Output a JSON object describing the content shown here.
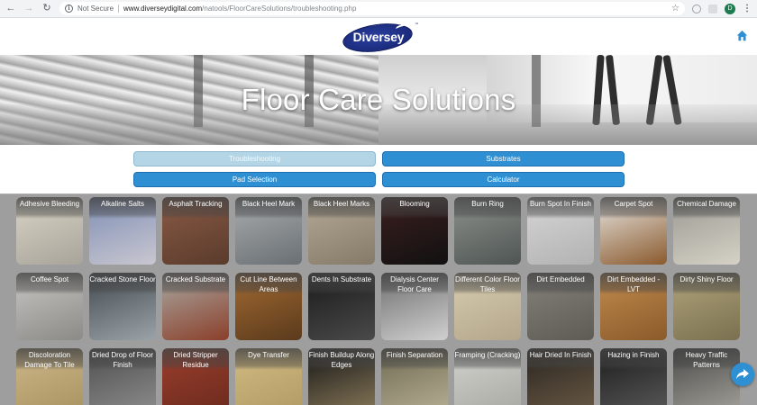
{
  "browser": {
    "security": "Not Secure",
    "url_host": "www.diverseydigital.com",
    "url_path": "/natools/FloorCareSolutions/troubleshooting.php",
    "profile_initial": "D"
  },
  "header": {
    "logo_text": "Diversey",
    "logo_tm": "™"
  },
  "hero": {
    "title": "Floor Care Solutions"
  },
  "nav_buttons": {
    "troubleshooting": "Troubleshooting",
    "substrates": "Substrates",
    "pad_selection": "Pad Selection",
    "calculator": "Calculator"
  },
  "colors": {
    "accent": "#2f8fd3",
    "active_button": "#b4d5e5",
    "brand_navy": "#1a2a7a"
  },
  "tiles": [
    {
      "label": "Adhesive Bleeding",
      "c1": "#d9d4c6",
      "c2": "#a8a49a"
    },
    {
      "label": "Alkaline Salts",
      "c1": "#7f8fb5",
      "c2": "#c9c7d0"
    },
    {
      "label": "Asphalt Tracking",
      "c1": "#8a5a45",
      "c2": "#5a3b2c"
    },
    {
      "label": "Black Heel Mark",
      "c1": "#a9adb0",
      "c2": "#6a6f73"
    },
    {
      "label": "Black Heel Marks",
      "c1": "#b5aa97",
      "c2": "#857a68"
    },
    {
      "label": "Blooming",
      "c1": "#3d1f1f",
      "c2": "#111111"
    },
    {
      "label": "Burn Ring",
      "c1": "#8c918e",
      "c2": "#4f5552"
    },
    {
      "label": "Burn Spot In Finish",
      "c1": "#d6d6d6",
      "c2": "#b2b2b2"
    },
    {
      "label": "Carpet Spot",
      "c1": "#e8e6e2",
      "c2": "#8a5a2e"
    },
    {
      "label": "Chemical Damage",
      "c1": "#9a9a92",
      "c2": "#d5d1c6"
    },
    {
      "label": "Coffee Spot",
      "c1": "#c8c6c2",
      "c2": "#8c8a86"
    },
    {
      "label": "Cracked Stone Floor",
      "c1": "#434a4f",
      "c2": "#9aa3a8"
    },
    {
      "label": "Cracked Substrate",
      "c1": "#a9a9a3",
      "c2": "#8b3f2a"
    },
    {
      "label": "Cut Line Between Areas",
      "c1": "#a36a32",
      "c2": "#5a3a1c"
    },
    {
      "label": "Dents In Substrate",
      "c1": "#1a1a1a",
      "c2": "#4a4a4a"
    },
    {
      "label": "Dialysis Center Floor Care",
      "c1": "#6f6f6f",
      "c2": "#d0d0d0"
    },
    {
      "label": "Different Color Floor Tiles",
      "c1": "#d8ccb0",
      "c2": "#b3a68a"
    },
    {
      "label": "Dirt Embedded",
      "c1": "#85827b",
      "c2": "#5e5b55"
    },
    {
      "label": "Dirt Embedded - LVT",
      "c1": "#c28c4e",
      "c2": "#8a5a2a"
    },
    {
      "label": "Dirty Shiny Floor",
      "c1": "#b0a47a",
      "c2": "#7a7050"
    },
    {
      "label": "Discoloration Damage To Tile",
      "c1": "#cdb78a",
      "c2": "#a8925f"
    },
    {
      "label": "Dried Drop of Floor Finish",
      "c1": "#4e4e4e",
      "c2": "#8e8e8e"
    },
    {
      "label": "Dried Stripper Residue",
      "c1": "#9b3e2c",
      "c2": "#6a2a1d"
    },
    {
      "label": "Dye Transfer",
      "c1": "#d3bb83",
      "c2": "#b09a63"
    },
    {
      "label": "Finish Buildup Along Edges",
      "c1": "#161616",
      "c2": "#8a7a5a"
    },
    {
      "label": "Finish Separation",
      "c1": "#6f6a52",
      "c2": "#b8b095"
    },
    {
      "label": "Framping (Cracking)",
      "c1": "#d2d2ce",
      "c2": "#a8a8a2"
    },
    {
      "label": "Hair Dried In Finish",
      "c1": "#2a2520",
      "c2": "#6a5a45"
    },
    {
      "label": "Hazing in Finish",
      "c1": "#1c1c1c",
      "c2": "#5a5a5a"
    },
    {
      "label": "Heavy Traffic Patterns",
      "c1": "#4a4a48",
      "c2": "#a5a39c"
    }
  ]
}
